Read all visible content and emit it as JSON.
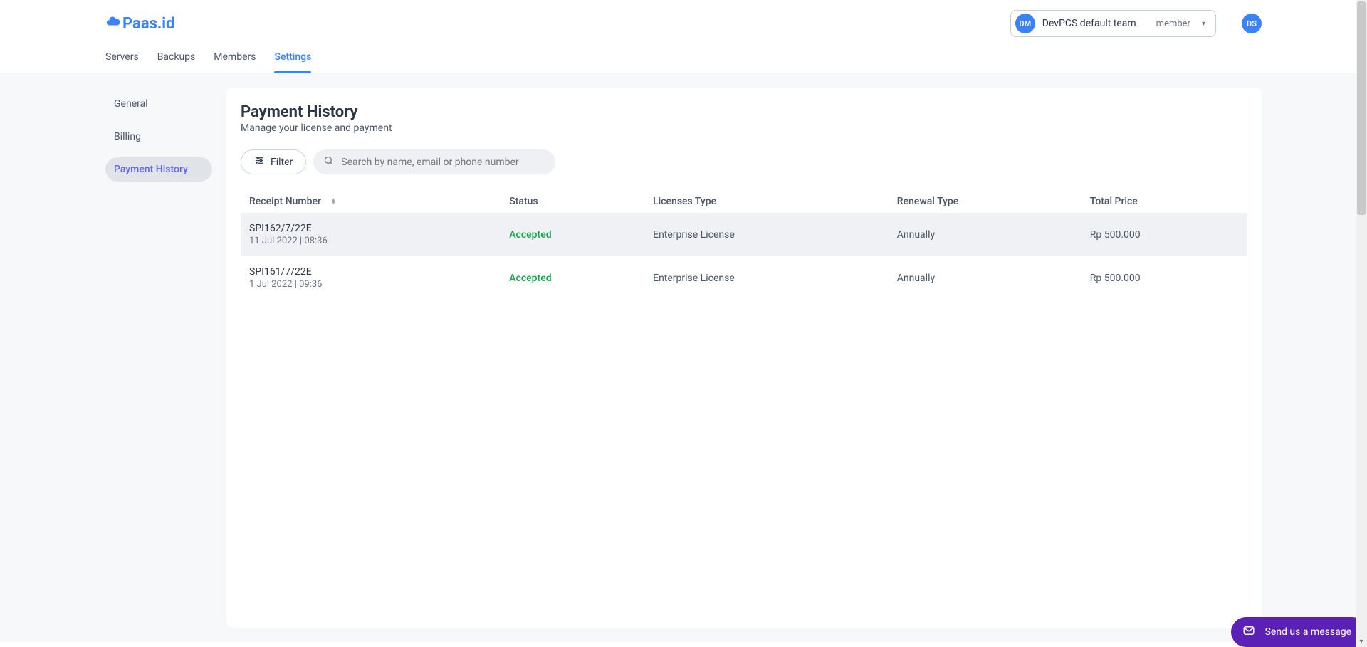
{
  "logo_text": "Paas.id",
  "team": {
    "avatar": "DM",
    "name": "DevPCS default team",
    "role": "member"
  },
  "user": {
    "avatar": "DS"
  },
  "nav": {
    "items": [
      {
        "label": "Servers",
        "active": false
      },
      {
        "label": "Backups",
        "active": false
      },
      {
        "label": "Members",
        "active": false
      },
      {
        "label": "Settings",
        "active": true
      }
    ]
  },
  "sidebar": {
    "items": [
      {
        "label": "General",
        "active": false
      },
      {
        "label": "Billing",
        "active": false
      },
      {
        "label": "Payment History",
        "active": true
      }
    ]
  },
  "page": {
    "title": "Payment History",
    "subtitle": "Manage your license and payment"
  },
  "controls": {
    "filter_label": "Filter",
    "search_placeholder": "Search by name, email or phone number"
  },
  "table": {
    "columns": {
      "receipt": "Receipt Number",
      "status": "Status",
      "license": "Licenses Type",
      "renewal": "Renewal Type",
      "total": "Total Price"
    },
    "rows": [
      {
        "receipt_number": "SPI162/7/22E",
        "receipt_date": "11 Jul 2022 | 08:36",
        "status": "Accepted",
        "license_type": "Enterprise License",
        "renewal_type": "Annually",
        "total_price": "Rp 500.000"
      },
      {
        "receipt_number": "SPI161/7/22E",
        "receipt_date": "1 Jul 2022 | 09:36",
        "status": "Accepted",
        "license_type": "Enterprise License",
        "renewal_type": "Annually",
        "total_price": "Rp 500.000"
      }
    ]
  },
  "chat": {
    "label": "Send us a message"
  }
}
